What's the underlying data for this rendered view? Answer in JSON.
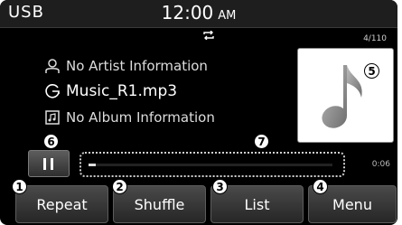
{
  "status_bar": {
    "source": "USB",
    "time": "12:00",
    "ampm": "AM"
  },
  "track_counter": "4/110",
  "track": {
    "artist": "No Artist Information",
    "title": "Music_R1.mp3",
    "album": "No Album Information"
  },
  "playback": {
    "elapsed": "0:06",
    "progress_fraction": 0.03
  },
  "softkeys": {
    "repeat": "Repeat",
    "shuffle": "Shuffle",
    "list": "List",
    "menu": "Menu"
  },
  "callouts": {
    "repeat": "1",
    "shuffle": "2",
    "list": "3",
    "menu": "4",
    "album_art": "5",
    "play_pause": "6",
    "progress": "7"
  },
  "icons": {
    "artist": "person-icon",
    "title": "music-file-icon",
    "album": "album-icon",
    "repeat_indicator": "repeat-icon",
    "album_art": "music-note-icon",
    "play_pause": "pause-icon"
  },
  "colors": {
    "screen_bg": "#000000",
    "button_top": "#4a4a4a",
    "button_bottom": "#262626",
    "callout_bg": "#ffffff"
  }
}
